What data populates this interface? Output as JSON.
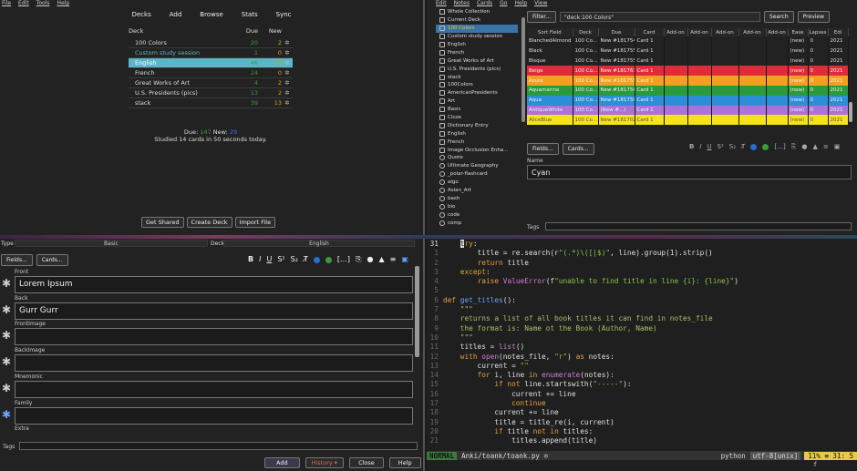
{
  "top_left": {
    "menu": [
      "File",
      "Edit",
      "Tools",
      "Help"
    ],
    "toolbar": [
      "Decks",
      "Add",
      "Browse",
      "Stats",
      "Sync"
    ],
    "headers": {
      "deck": "Deck",
      "due": "Due",
      "new": "New"
    },
    "decks": [
      {
        "name": "100 Colors",
        "due": "20",
        "new": "2"
      },
      {
        "name": "Custom study session",
        "due": "1",
        "new": "0"
      },
      {
        "name": "English",
        "due": "46",
        "new": "10"
      },
      {
        "name": "French",
        "due": "24",
        "new": "0"
      },
      {
        "name": "Great Works of Art",
        "due": "4",
        "new": "2"
      },
      {
        "name": "U.S. Presidents (pics)",
        "due": "13",
        "new": "2"
      },
      {
        "name": "stack",
        "due": "39",
        "new": "13"
      }
    ],
    "due_line": {
      "label_due": "Due:",
      "due": "147",
      "label_new": "New:",
      "new": "29"
    },
    "studied": "Studied 14 cards in 50 seconds today.",
    "buttons": [
      "Get Shared",
      "Create Deck",
      "Import File"
    ]
  },
  "top_right": {
    "menu": [
      "Edit",
      "Notes",
      "Cards",
      "Go",
      "Help",
      "View"
    ],
    "filter_button": "Filter...",
    "search_value": "\"deck:100 Colors\"",
    "search_button": "Search",
    "preview_button": "Preview",
    "sidebar": [
      "Whole Collection",
      "Current Deck",
      "100 Colors",
      "Custom study session",
      "English",
      "French",
      "Great Works of Art",
      "U.S. Presidents (pics)",
      "stack",
      "100Colors",
      "AmericanPresidents",
      "Art",
      "Basic",
      "Cloze",
      "Dictionary Entry",
      "English",
      "French",
      "Image Occlusion Enha...",
      "Quote",
      "Ultimate Geography",
      "_polar-flashcard",
      "algo",
      "Asian_Art",
      "bash",
      "bio",
      "code",
      "comp"
    ],
    "columns": [
      "Sort Field",
      "Deck",
      "Due",
      "Card",
      "Add-on",
      "Add-on",
      "Add-on",
      "Add-on",
      "Add-on",
      "Ease",
      "Lapses",
      "Edi"
    ],
    "rows": [
      {
        "sort": "BlanchedAlmond",
        "deck": "100 Co...",
        "due": "New #1817549",
        "card": "Card 1",
        "ease": "(new)",
        "lapses": "0",
        "edit": "2021",
        "color": "#222222",
        "text": "#dddddd"
      },
      {
        "sort": "Black",
        "deck": "100 Co...",
        "due": "New #1817550",
        "card": "Card 1",
        "ease": "(new)",
        "lapses": "0",
        "edit": "2021",
        "color": "#222222",
        "text": "#dddddd"
      },
      {
        "sort": "Bisque",
        "deck": "100 Co...",
        "due": "New #1817550",
        "card": "Card 1",
        "ease": "(new)",
        "lapses": "0",
        "edit": "2021",
        "color": "#222222",
        "text": "#dddddd"
      },
      {
        "sort": "Beige",
        "deck": "100 Co...",
        "due": "New #1817639",
        "card": "Card 1",
        "ease": "(new)",
        "lapses": "0",
        "edit": "2021",
        "color": "#e02b3a",
        "text": "#f2f2f2"
      },
      {
        "sort": "Azure",
        "deck": "100 Co...",
        "due": "New #1817552",
        "card": "Card 1",
        "ease": "(new)",
        "lapses": "0",
        "edit": "2021",
        "color": "#f2a020",
        "text": "#f2f2f2"
      },
      {
        "sort": "Aquamarine",
        "deck": "100 Co...",
        "due": "New #1817569",
        "card": "Card 1",
        "ease": "(new)",
        "lapses": "0",
        "edit": "2021",
        "color": "#2a9a3c",
        "text": "#f2f2f2"
      },
      {
        "sort": "Aqua",
        "deck": "100 Co...",
        "due": "New #1817565",
        "card": "Card 1",
        "ease": "(new)",
        "lapses": "0",
        "edit": "2021",
        "color": "#2a8fd6",
        "text": "#f2f2f2"
      },
      {
        "sort": "AntiqueWhite",
        "deck": "100 Co...",
        "due": "(New #...)",
        "card": "Card 1",
        "ease": "(new)",
        "lapses": "0",
        "edit": "2021",
        "color": "#b070d8",
        "text": "#f2f2f2"
      },
      {
        "sort": "AliceBlue",
        "deck": "100 Co...",
        "due": "New #1817025",
        "card": "Card 1",
        "ease": "(new)",
        "lapses": "0",
        "edit": "2021",
        "color": "#f5e21a",
        "text": "#555555"
      }
    ],
    "fields_button": "Fields...",
    "cards_button": "Cards...",
    "name_label": "Name",
    "name_value": "Cyan",
    "tags_label": "Tags"
  },
  "bottom_left": {
    "type_label": "Type",
    "type_value": "Basic",
    "deck_label": "Deck",
    "deck_value": "English",
    "fields_button": "Fields...",
    "cards_button": "Cards...",
    "fields": [
      {
        "label": "Front",
        "value": "Lorem Ipsum"
      },
      {
        "label": "Back",
        "value": "Gurr Gurr"
      },
      {
        "label": "FrontImage",
        "value": ""
      },
      {
        "label": "BackImage",
        "value": ""
      },
      {
        "label": "Mnemonic",
        "value": ""
      },
      {
        "label": "Family",
        "value": ""
      },
      {
        "label": "Extra",
        "value": ""
      }
    ],
    "tags_label": "Tags",
    "buttons": {
      "add": "Add",
      "history": "History ▾",
      "close": "Close",
      "help": "Help"
    }
  },
  "bottom_right": {
    "lines": [
      {
        "n": "31",
        "cur": true,
        "html": "    <span class='cursor'>t</span><span class='kw'>ry</span>:"
      },
      {
        "n": "1",
        "html": "        title = re.search(r<span class='str'>\"(.*)\\([|$)\"</span>, line).group(1).strip()"
      },
      {
        "n": "2",
        "html": "        <span class='kw'>return</span> title"
      },
      {
        "n": "3",
        "html": "    <span class='kw'>except</span>:"
      },
      {
        "n": "4",
        "html": "        <span class='kw'>raise</span> <span class='bi'>ValueError</span>(f<span class='str'>\"unable to find title in line {i}: {line}\"</span>)"
      },
      {
        "n": "5",
        "html": ""
      },
      {
        "n": "6",
        "html": "<span class='kw'>def</span> <span class='fn'>get_titles</span>():"
      },
      {
        "n": "7",
        "html": "    <span class='cm'>\"\"\"</span>"
      },
      {
        "n": "8",
        "html": "    <span class='cm'>returns a list of all book titles it can find in notes_file</span>"
      },
      {
        "n": "9",
        "html": "    <span class='cm'>the format is: Name ot the Book (Author, Name)</span>"
      },
      {
        "n": "10",
        "html": "    <span class='cm'>\"\"\"</span>"
      },
      {
        "n": "11",
        "html": "    titles = <span class='bi'>list</span>()"
      },
      {
        "n": "12",
        "html": "    <span class='kw'>with</span> <span class='bi'>open</span>(notes_file, <span class='str'>\"r\"</span>) <span class='kw'>as</span> notes:"
      },
      {
        "n": "13",
        "html": "        current = <span class='str'>\"\"</span>"
      },
      {
        "n": "14",
        "html": "        <span class='kw'>for</span> i, line <span class='kw'>in</span> <span class='bi'>enumerate</span>(notes):"
      },
      {
        "n": "15",
        "html": "            <span class='kw'>if not</span> line.startswith(<span class='str'>\"-----\"</span>):"
      },
      {
        "n": "16",
        "html": "                current += line"
      },
      {
        "n": "17",
        "html": "                <span class='kw'>continue</span>"
      },
      {
        "n": "18",
        "html": "            current += line"
      },
      {
        "n": "19",
        "html": "            title = title_re(i, current)"
      },
      {
        "n": "20",
        "html": "            <span class='kw'>if</span> title <span class='kw'>not in</span> titles:"
      },
      {
        "n": "21",
        "html": "                titles.append(title)"
      }
    ],
    "status": {
      "mode": "NORMAL",
      "file": "Anki/toank/toank.py ⊙",
      "filetype": "python",
      "encoding": "utf-8[unix]",
      "percent": "11%",
      "pos": "31:  5"
    },
    "cmdline": "f"
  }
}
